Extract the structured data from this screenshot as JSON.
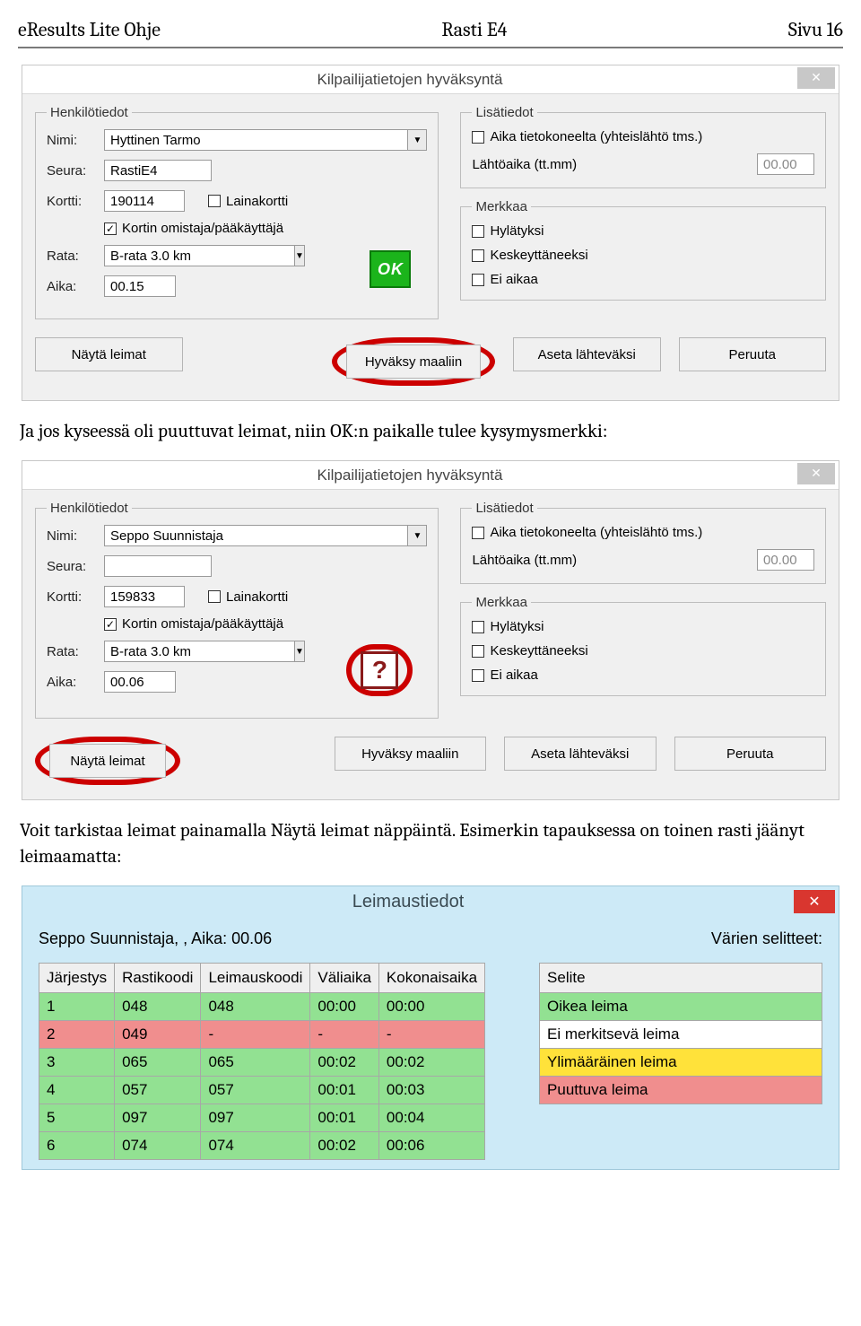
{
  "header": {
    "left": "eResults Lite Ohje",
    "center": "Rasti E4",
    "right": "Sivu 16"
  },
  "narrative1": "Ja jos kyseessä oli puuttuvat leimat, niin OK:n paikalle tulee kysymysmerkki:",
  "narrative2a": "Voit tarkistaa leimat painamalla Näytä leimat näppäintä. Esimerkin tapauksessa on toinen rasti jäänyt",
  "narrative2b": "leimaamatta:",
  "dlg_shared": {
    "title": "Kilpailijatietojen hyväksyntä",
    "grp_person": "Henkilötiedot",
    "grp_extra": "Lisätiedot",
    "grp_mark": "Merkkaa",
    "lbl_name": "Nimi:",
    "lbl_club": "Seura:",
    "lbl_card": "Kortti:",
    "lbl_course": "Rata:",
    "lbl_time": "Aika:",
    "chk_loan": "Lainakortti",
    "chk_owner": "Kortin omistaja/pääkäyttäjä",
    "chk_computer_time": "Aika tietokoneelta (yhteislähtö tms.)",
    "lbl_start": "Lähtöaika (tt.mm)",
    "chk_dq": "Hylätyksi",
    "chk_dnf": "Keskeyttäneeksi",
    "chk_notime": "Ei aikaa",
    "btn_show": "Näytä leimat",
    "btn_accept": "Hyväksy maaliin",
    "btn_start": "Aseta lähteväksi",
    "btn_cancel": "Peruuta"
  },
  "dlg1": {
    "name": "Hyttinen Tarmo",
    "club": "RastiE4",
    "card": "190114",
    "course": "B-rata 3.0 km",
    "time": "00.15",
    "start_time": "00.00",
    "badge": "OK"
  },
  "dlg2": {
    "name": "Seppo Suunnistaja",
    "club": "",
    "card": "159833",
    "course": "B-rata 3.0 km",
    "time": "00.06",
    "start_time": "00.00",
    "badge": "?"
  },
  "punch": {
    "title": "Leimaustiedot",
    "header_left": "Seppo Suunnistaja, ,  Aika: 00.06",
    "header_right": "Värien selitteet:",
    "cols": [
      "Järjestys",
      "Rastikoodi",
      "Leimauskoodi",
      "Väliaika",
      "Kokonaisaika"
    ],
    "rows": [
      {
        "c": [
          "1",
          "048",
          "048",
          "00:00",
          "00:00"
        ],
        "bg": "green"
      },
      {
        "c": [
          "2",
          "049",
          "-",
          "-",
          "-"
        ],
        "bg": "red"
      },
      {
        "c": [
          "3",
          "065",
          "065",
          "00:02",
          "00:02"
        ],
        "bg": "green"
      },
      {
        "c": [
          "4",
          "057",
          "057",
          "00:01",
          "00:03"
        ],
        "bg": "green"
      },
      {
        "c": [
          "5",
          "097",
          "097",
          "00:01",
          "00:04"
        ],
        "bg": "green"
      },
      {
        "c": [
          "6",
          "074",
          "074",
          "00:02",
          "00:06"
        ],
        "bg": "green"
      }
    ],
    "legend_header": "Selite",
    "legend": [
      {
        "t": "Oikea leima",
        "bg": "green"
      },
      {
        "t": "Ei merkitsevä leima",
        "bg": "white"
      },
      {
        "t": "Ylimääräinen leima",
        "bg": "yellow"
      },
      {
        "t": "Puuttuva leima",
        "bg": "red"
      }
    ]
  }
}
